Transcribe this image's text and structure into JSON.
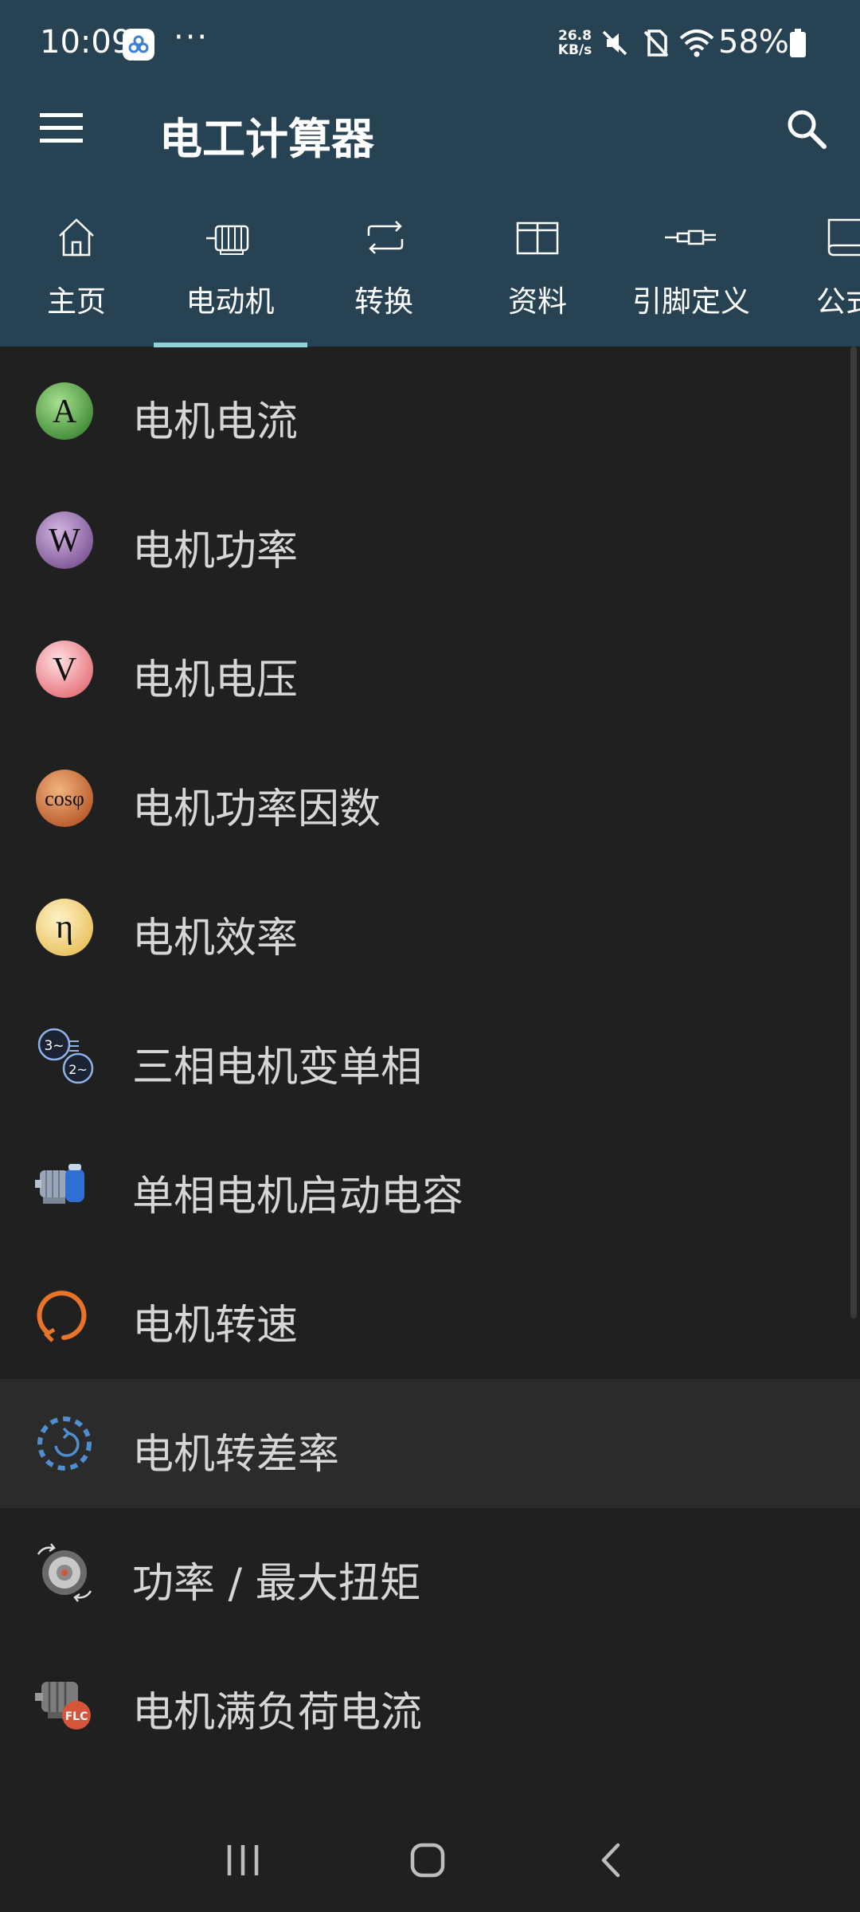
{
  "status_bar": {
    "time": "10:09",
    "dots": "···",
    "speed_value": "26.8",
    "speed_unit": "KB/s",
    "battery": "58%"
  },
  "app_bar": {
    "title": "电工计算器",
    "tabs": [
      {
        "label": "主页",
        "icon": "home-icon"
      },
      {
        "label": "电动机",
        "icon": "motor-icon"
      },
      {
        "label": "转换",
        "icon": "repeat-icon"
      },
      {
        "label": "资料",
        "icon": "table-icon"
      },
      {
        "label": "引脚定义",
        "icon": "connector-icon"
      },
      {
        "label": "公式",
        "icon": "book-icon"
      }
    ],
    "selected_tab": 1
  },
  "list": [
    {
      "label": "电机电流",
      "icon": "circle-A-icon",
      "glyph": "A",
      "color": "#5aa14a"
    },
    {
      "label": "电机功率",
      "icon": "circle-W-icon",
      "glyph": "W",
      "color": "#9c74b0"
    },
    {
      "label": "电机电压",
      "icon": "circle-V-icon",
      "glyph": "V",
      "color": "#f08d92"
    },
    {
      "label": "电机功率因数",
      "icon": "circle-cos-icon",
      "glyph": "cosφ",
      "color": "#d2743a"
    },
    {
      "label": "电机效率",
      "icon": "circle-eta-icon",
      "glyph": "η",
      "color": "#f2d27a"
    },
    {
      "label": "三相电机变单相",
      "icon": "phase-convert-icon",
      "glyph": "",
      "color": "#6b9ad8"
    },
    {
      "label": "单相电机启动电容",
      "icon": "motor-capacitor-icon",
      "glyph": "",
      "color": "#6f8fb8"
    },
    {
      "label": "电机转速",
      "icon": "rotation-arrow-icon",
      "glyph": "",
      "color": "#e8742a"
    },
    {
      "label": "电机转差率",
      "icon": "slip-circle-icon",
      "glyph": "",
      "color": "#4f8fd0"
    },
    {
      "label": "功率 / 最大扭矩",
      "icon": "torque-icon",
      "glyph": "",
      "color": "#8a8a8a"
    },
    {
      "label": "电机满负荷电流",
      "icon": "motor-flc-icon",
      "glyph": "FLC",
      "color": "#d4553a"
    }
  ],
  "highlighted_index": 8
}
